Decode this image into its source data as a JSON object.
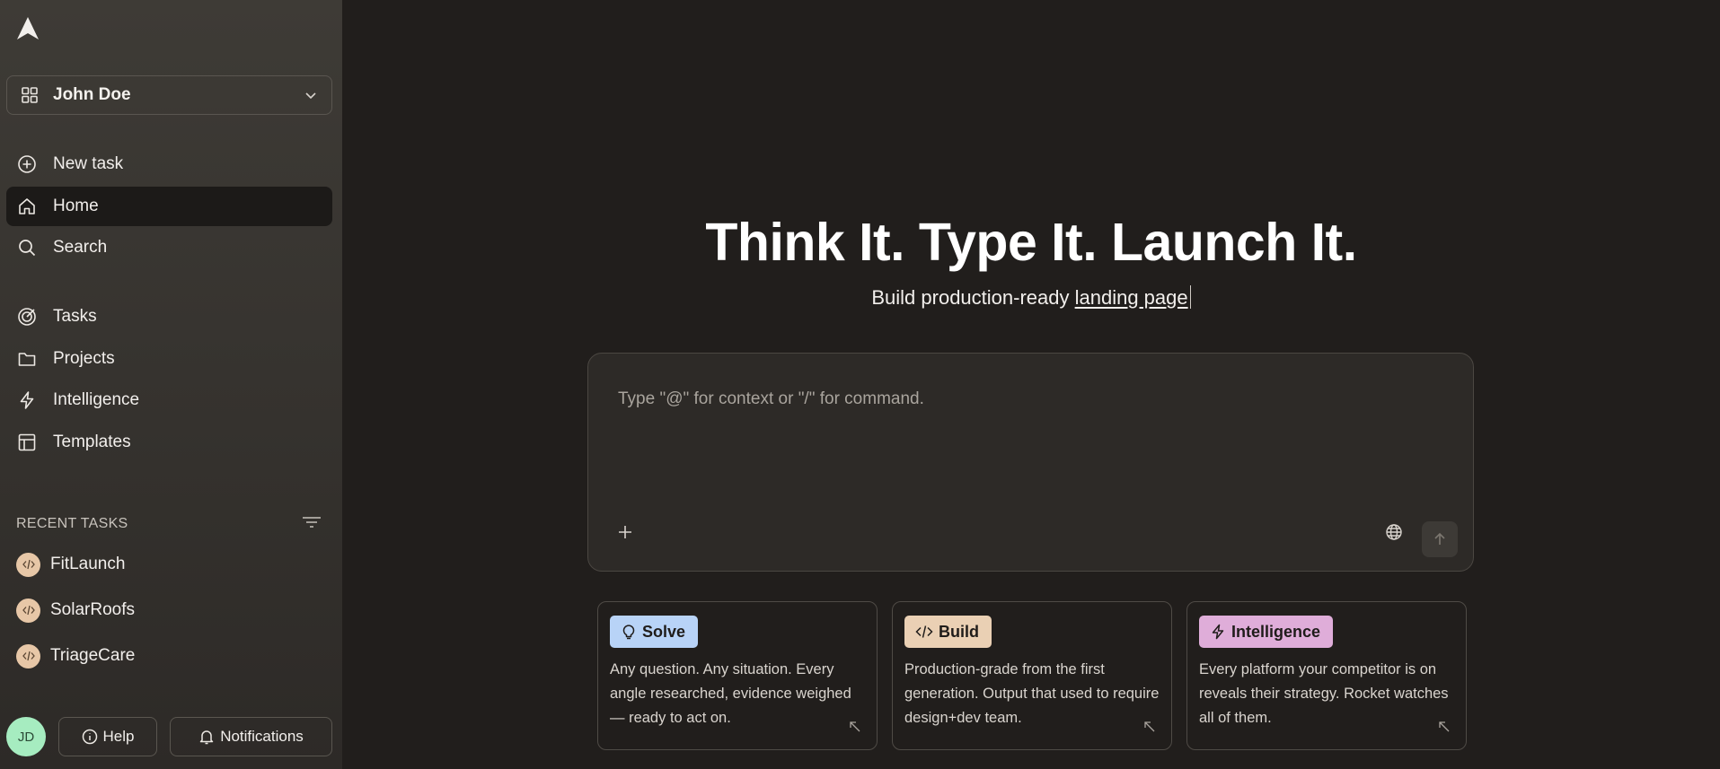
{
  "sidebar": {
    "workspace": {
      "name": "John Doe"
    },
    "nav": [
      {
        "label": "New task",
        "icon": "plus-circle-icon"
      },
      {
        "label": "Home",
        "icon": "home-icon",
        "active": true
      },
      {
        "label": "Search",
        "icon": "search-icon"
      },
      {
        "label": "Tasks",
        "icon": "target-icon"
      },
      {
        "label": "Projects",
        "icon": "folder-icon"
      },
      {
        "label": "Intelligence",
        "icon": "lightning-icon"
      },
      {
        "label": "Templates",
        "icon": "layout-icon"
      }
    ],
    "recent": {
      "header": "RECENT TASKS",
      "items": [
        {
          "label": "FitLaunch",
          "icon": "code-icon"
        },
        {
          "label": "SolarRoofs",
          "icon": "code-icon"
        },
        {
          "label": "TriageCare",
          "icon": "code-icon"
        }
      ]
    },
    "bottom": {
      "avatar_initials": "JD",
      "help_label": "Help",
      "notifications_label": "Notifications"
    }
  },
  "hero": {
    "title": "Think It. Type It. Launch It.",
    "subtitle_prefix": "Build production-ready ",
    "subtitle_highlight": "landing page"
  },
  "composer": {
    "placeholder": "Type \"@\" for context or \"/\" for command."
  },
  "cards": [
    {
      "tag": "Solve",
      "icon": "lightbulb-icon",
      "color": "#b8d3f7",
      "desc": "Any question. Any situation. Every angle researched, evidence weighed — ready to act on."
    },
    {
      "tag": "Build",
      "icon": "code-icon",
      "color": "#ead0b4",
      "desc": "Production-grade from the first generation. Output that used to require design+dev team."
    },
    {
      "tag": "Intelligence",
      "icon": "lightning-icon",
      "color": "#dfadd9",
      "desc": "Every platform your competitor is on reveals their strategy. Rocket watches all of them."
    }
  ],
  "colors": {
    "accent_avatar": "#a6ecc0",
    "recent_icon_bg": "#e7c7a7"
  }
}
